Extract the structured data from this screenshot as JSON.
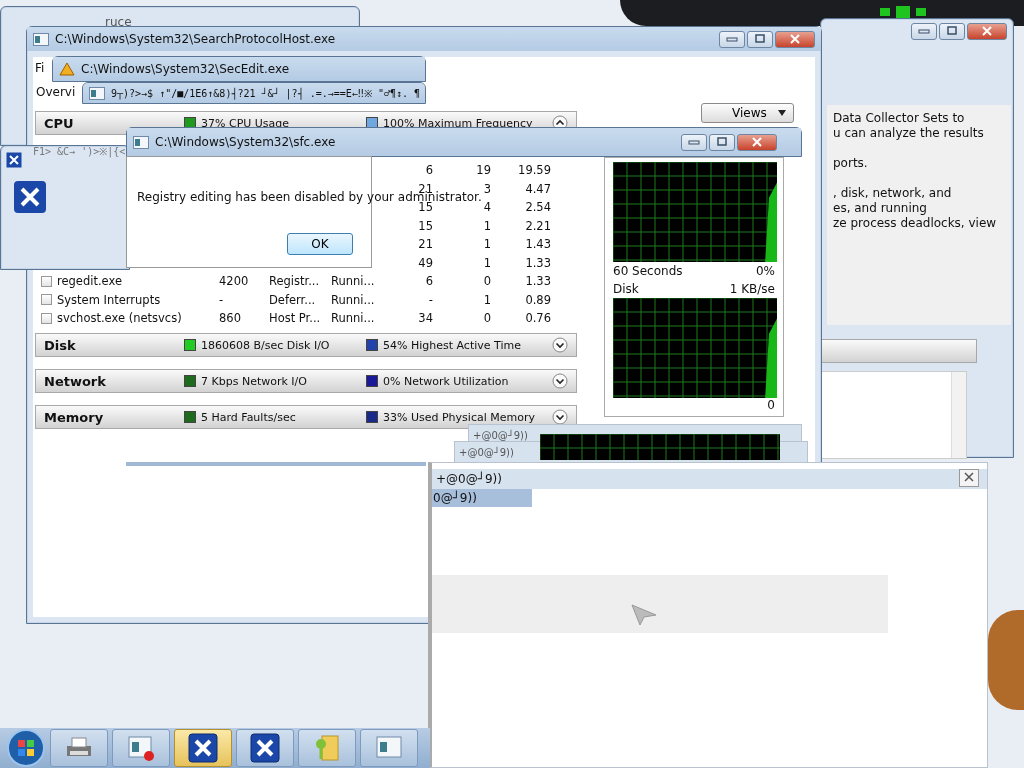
{
  "back_window": {
    "title_fragment": "ruce"
  },
  "search_protocol_window": {
    "title": "C:\\Windows\\System32\\SearchProtocolHost.exe",
    "menu_fragment": "Fi",
    "tab_fragment": "Overvi"
  },
  "secedit_window": {
    "title": "C:\\Windows\\System32\\SecEdit.exe"
  },
  "garbled_window": {
    "title": "9┬)?>→$  ↑\"/■/1E6↑&8)┤?21 ┘&┘ |?┤  .=.→==E←‼※ \"♂¶↕. ¶",
    "line": "F1> &C→ ')>※|{<"
  },
  "resource_monitor": {
    "cpu": {
      "label": "CPU",
      "metrics": [
        {
          "text": "37% CPU Usage",
          "color": "#1f9a1f"
        },
        {
          "text": "100% Maximum Frequency",
          "color": "#6fa8e0"
        }
      ]
    },
    "processes": [
      {
        "threads": "6",
        "cpu": "19",
        "avg_cpu": "19.59"
      },
      {
        "threads": "21",
        "cpu": "3",
        "avg_cpu": "4.47"
      },
      {
        "threads": "15",
        "cpu": "4",
        "avg_cpu": "2.54"
      },
      {
        "threads": "15",
        "cpu": "1",
        "avg_cpu": "2.21"
      },
      {
        "threads": "21",
        "cpu": "1",
        "avg_cpu": "1.43"
      },
      {
        "threads": "49",
        "cpu": "1",
        "avg_cpu": "1.33"
      },
      {
        "checked": false,
        "image": "regedit.exe",
        "pid": "4200",
        "description": "Registr...",
        "status": "Runni...",
        "threads": "6",
        "cpu": "0",
        "avg_cpu": "1.33"
      },
      {
        "checked": false,
        "image": "System Interrupts",
        "pid": "-",
        "description": "Deferr...",
        "status": "Runni...",
        "threads": "-",
        "cpu": "1",
        "avg_cpu": "0.89"
      },
      {
        "checked": false,
        "image": "svchost.exe (netsvcs)",
        "pid": "860",
        "description": "Host Pr...",
        "status": "Runni...",
        "threads": "34",
        "cpu": "0",
        "avg_cpu": "0.76"
      }
    ],
    "sections": [
      {
        "label": "Disk",
        "metrics": [
          {
            "text": "1860608 B/sec Disk I/O",
            "color": "#22cc22"
          },
          {
            "text": "54% Highest Active Time",
            "color": "#2244aa"
          }
        ]
      },
      {
        "label": "Network",
        "metrics": [
          {
            "text": "7 Kbps Network I/O",
            "color": "#1e6b1e"
          },
          {
            "text": "0% Network Utilization",
            "color": "#1a1a99"
          }
        ]
      },
      {
        "label": "Memory",
        "metrics": [
          {
            "text": "5 Hard Faults/sec",
            "color": "#1e6b1e"
          },
          {
            "text": "33% Used Physical Memory",
            "color": "#1a2a88"
          }
        ]
      }
    ]
  },
  "sfc_window": {
    "title": "C:\\Windows\\System32\\sfc.exe",
    "message": "Registry editing has been disabled by your administrator.",
    "button": "OK"
  },
  "graphs_panel": {
    "views_button": "Views",
    "graphs": [
      {
        "caption": "60 Seconds",
        "value": "0%"
      },
      {
        "caption": "Disk",
        "value": "1 KB/se"
      }
    ],
    "axis_fragment": "0"
  },
  "help_panel": {
    "paragraphs": [
      [
        "Data Collector Sets to",
        "u can analyze the results"
      ],
      [
        "ports."
      ],
      [
        ", disk, network, and",
        "es, and running",
        "ze process deadlocks, view"
      ]
    ]
  },
  "garbled_dialogs": [
    {
      "title": "+@0@┘9))"
    },
    {
      "title": "+@0@┘9))"
    }
  ],
  "front_dialog": {
    "title": "+@0@┘9))",
    "items": [
      {
        "label": "0@┘9))",
        "selected": true
      }
    ]
  },
  "taskbar": {
    "buttons": [
      {
        "kind": "printer",
        "active": false
      },
      {
        "kind": "window-stop",
        "active": false
      },
      {
        "kind": "x",
        "active": true
      },
      {
        "kind": "x",
        "active": false
      },
      {
        "kind": "key-folder",
        "active": false
      },
      {
        "kind": "window",
        "active": false
      }
    ]
  }
}
